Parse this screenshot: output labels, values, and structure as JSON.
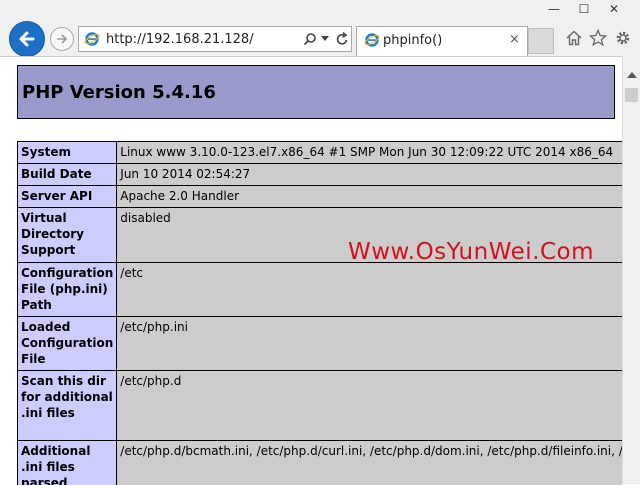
{
  "window": {
    "minimize": "—",
    "maximize": "☐",
    "close": "✕"
  },
  "address_bar": {
    "url": "http://192.168.21.128/"
  },
  "tab": {
    "title": "phpinfo()",
    "close": "×"
  },
  "page": {
    "heading": "PHP Version 5.4.16",
    "rows": [
      {
        "key": "System",
        "value": "Linux www 3.10.0-123.el7.x86_64 #1 SMP Mon Jun 30 12:09:22 UTC 2014 x86_64"
      },
      {
        "key": "Build Date",
        "value": "Jun 10 2014 02:54:27"
      },
      {
        "key": "Server API",
        "value": "Apache 2.0 Handler"
      },
      {
        "key": "Virtual Directory Support",
        "value": "disabled"
      },
      {
        "key": "Configuration File (php.ini) Path",
        "value": "/etc"
      },
      {
        "key": "Loaded Configuration File",
        "value": "/etc/php.ini"
      },
      {
        "key": "Scan this dir for additional .ini files",
        "value": "/etc/php.d"
      },
      {
        "key": "Additional .ini files parsed",
        "value": "/etc/php.d/bcmath.ini, /etc/php.d/curl.ini, /etc/php.d/dom.ini, /etc/php.d/fileinfo.ini, /etc/php.d/gd.ini"
      }
    ]
  },
  "watermark": "Www.OsYunWei.Com",
  "icons": [
    "back-arrow-icon",
    "forward-arrow-icon",
    "ie-logo-icon",
    "search-icon",
    "dropdown-icon",
    "refresh-icon",
    "close-icon",
    "home-icon",
    "star-icon",
    "gear-icon"
  ]
}
